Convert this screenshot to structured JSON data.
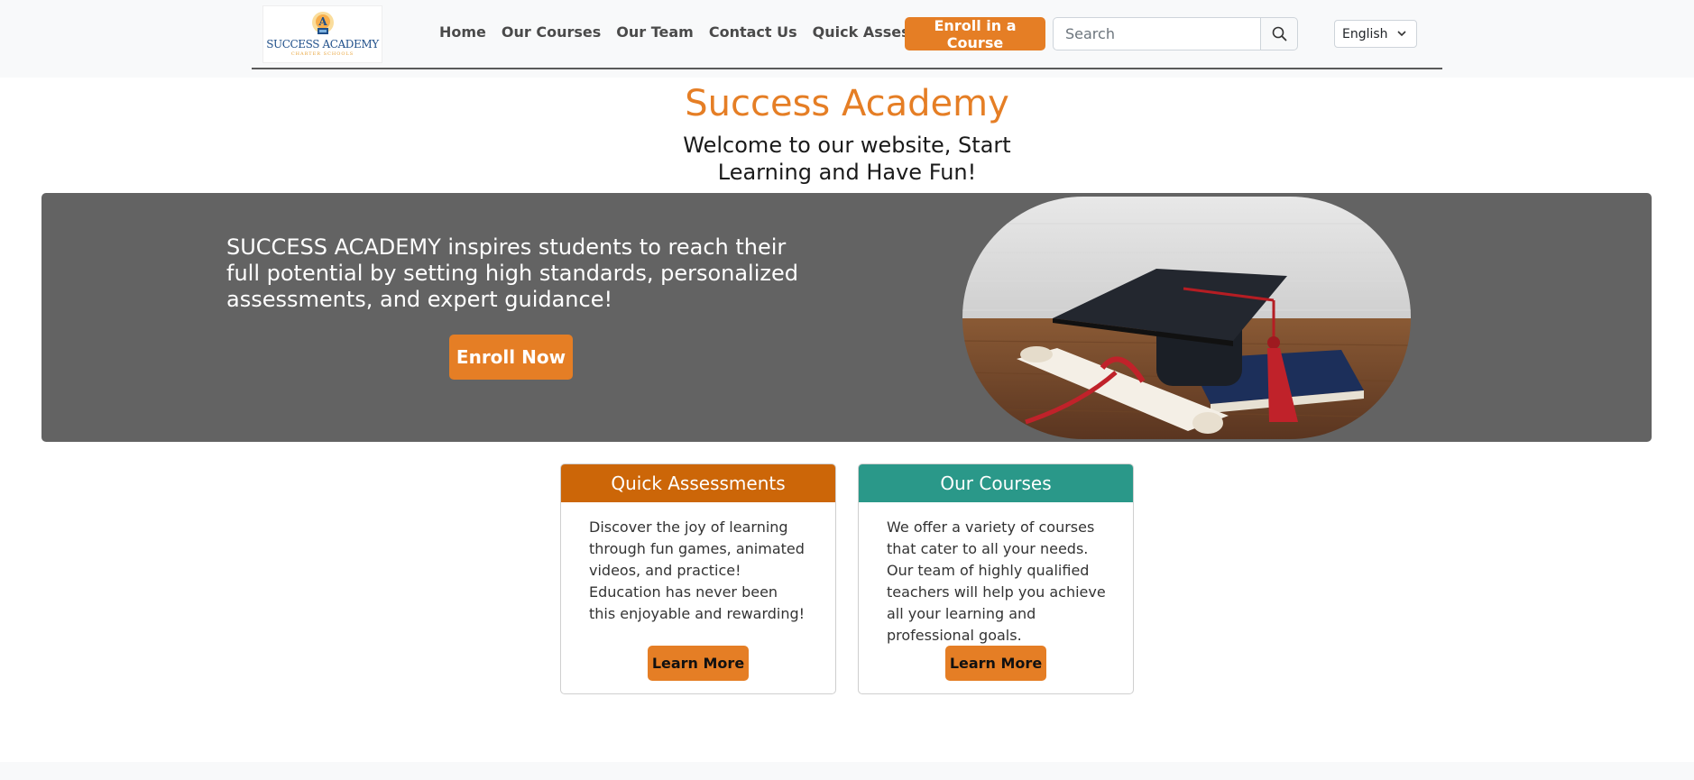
{
  "header": {
    "logo": {
      "name": "SUCCESS ACADEMY",
      "sub": "CHARTER SCHOOLS"
    },
    "nav": [
      "Home",
      "Our Courses",
      "Our Team",
      "Contact Us",
      "Quick Assessments"
    ],
    "enroll_label": "Enroll in a Course",
    "search_placeholder": "Search",
    "language": "English"
  },
  "main": {
    "title": "Success Academy",
    "welcome": "Welcome to our website, Start Learning and Have Fun!",
    "hero": {
      "text": "SUCCESS ACADEMY inspires students to reach their full potential by setting high standards, personalized assessments, and expert guidance!",
      "button": "Enroll Now"
    },
    "cards": [
      {
        "title": "Quick Assessments",
        "color": "#cc6608",
        "text": "Discover the joy of learning through fun games, animated videos, and practice! Education has never been this enjoyable and rewarding!",
        "button": "Learn More"
      },
      {
        "title": "Our Courses",
        "color": "#2a9889",
        "text": "We offer a variety of courses that cater to all your needs. Our team of highly qualified teachers will help you achieve all your learning and professional goals.",
        "button": "Learn More"
      }
    ]
  },
  "colors": {
    "accent": "#e57e25",
    "hero_bg": "#636363"
  }
}
